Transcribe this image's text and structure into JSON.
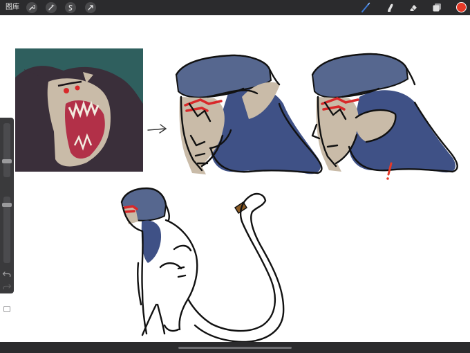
{
  "toolbar": {
    "gallery_label": "图库",
    "left_tools": [
      {
        "icon": "wrench-icon",
        "name": "actions"
      },
      {
        "icon": "magic-wand-icon",
        "name": "adjustments"
      },
      {
        "icon": "selection-icon",
        "name": "selection"
      },
      {
        "icon": "transform-arrow-icon",
        "name": "transform"
      }
    ],
    "right_tools": [
      {
        "icon": "brush-icon",
        "name": "paint",
        "active": true
      },
      {
        "icon": "smudge-icon",
        "name": "smudge",
        "active": false
      },
      {
        "icon": "eraser-icon",
        "name": "erase",
        "active": false
      },
      {
        "icon": "layers-icon",
        "name": "layers",
        "active": false
      }
    ],
    "current_color": "#e53a28",
    "active_tool_color": "#3d7bd9"
  },
  "sidebar": {
    "brush_size": 0.28,
    "opacity": 0.9
  },
  "canvas": {
    "palette": {
      "helmet_blue": "#56678f",
      "cloak_blue": "#3f5186",
      "skin_beige": "#c9bba8",
      "eye_red": "#d8282a",
      "line": "#111111",
      "photo_bg": "#2f5f5e",
      "fur_dark": "#3a2f3a",
      "mouth_red": "#b23048",
      "tail_band": "#8a5a24"
    }
  }
}
